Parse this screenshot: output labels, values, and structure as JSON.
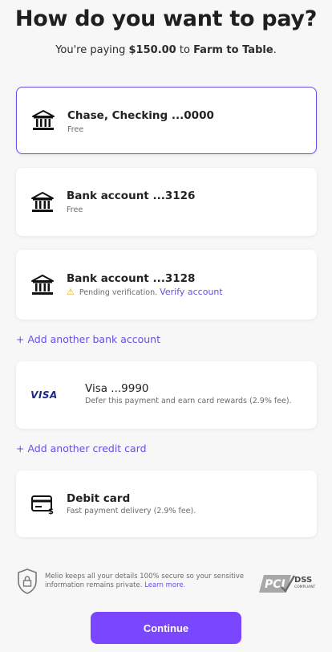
{
  "header": {
    "title": "How do you want to pay?",
    "subtitle_prefix": "You're paying ",
    "amount": "$150.00",
    "subtitle_middle": " to ",
    "payee": "Farm to Table",
    "subtitle_suffix": "."
  },
  "bank_accounts": [
    {
      "name": "Chase, Checking ...0000",
      "description": "Free",
      "selected": true,
      "icon": "bank-icon"
    },
    {
      "name": "Bank account ...3126",
      "description": "Free",
      "selected": false,
      "icon": "bank-icon"
    },
    {
      "name": "Bank account ...3128",
      "description": "Pending verification.",
      "action": "Verify account",
      "status_icon": "warning-icon",
      "selected": false,
      "icon": "bank-icon"
    }
  ],
  "add_bank_label": "+ Add another bank account",
  "credit_card": {
    "brand": "VISA",
    "name": "Visa ...9990",
    "description": "Defer this payment and earn card rewards (2.9% fee)."
  },
  "add_card_label": "+ Add another credit card",
  "debit_card": {
    "name": "Debit card",
    "description": "Fast payment delivery (2.9% fee).",
    "icon": "debit-card-icon"
  },
  "security": {
    "text": "Melio keeps all your details 100% secure so your sensitive information remains private.",
    "link": "Learn more.",
    "badge_main": "PCI",
    "badge_dss": "DSS",
    "badge_sub": "COMPLIANT"
  },
  "continue_label": "Continue",
  "colors": {
    "accent": "#7b46ff",
    "link": "#6b4ce6",
    "warning": "#e0a800",
    "visa": "#1a2a8c"
  }
}
